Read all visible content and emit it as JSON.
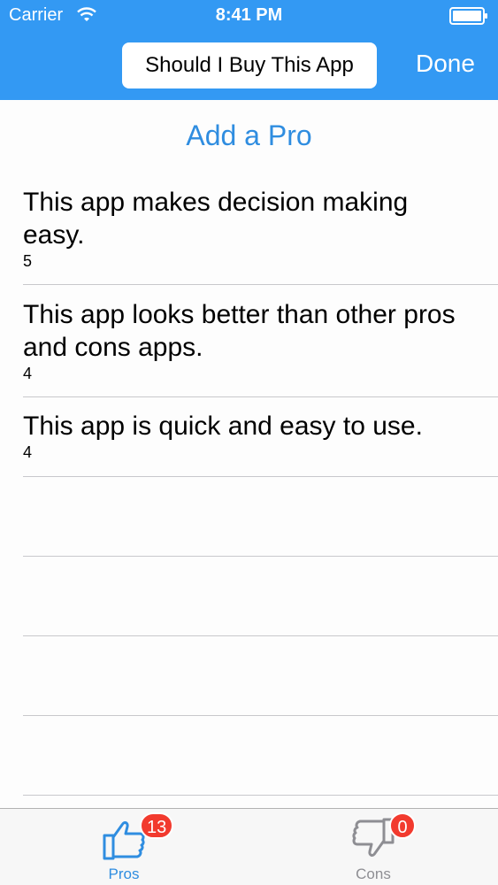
{
  "status_bar": {
    "carrier": "Carrier",
    "time": "8:41 PM",
    "icons": [
      "wifi-icon",
      "battery-icon"
    ]
  },
  "nav": {
    "title_value": "Should I Buy This App",
    "done_label": "Done"
  },
  "add_button": {
    "label": "Add a Pro"
  },
  "items": [
    {
      "text": "This app makes decision making easy.",
      "score": "5"
    },
    {
      "text": "This app looks better than other pros and cons apps.",
      "score": "4"
    },
    {
      "text": "This app is quick and easy to use.",
      "score": "4"
    }
  ],
  "tabs": [
    {
      "label": "Pros",
      "badge": "13",
      "icon": "thumbs-up-icon",
      "selected": true
    },
    {
      "label": "Cons",
      "badge": "0",
      "icon": "thumbs-down-icon",
      "selected": false
    }
  ],
  "colors": {
    "accent": "#3399f3",
    "link": "#2f8de0",
    "badge": "#f23a2e"
  }
}
